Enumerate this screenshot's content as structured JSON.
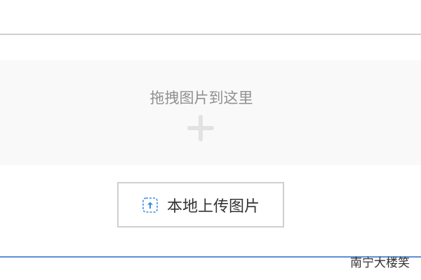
{
  "dropzone": {
    "hint": "拖拽图片到这里",
    "icon": "plus-icon"
  },
  "upload": {
    "label": "本地上传图片",
    "icon": "upload-icon",
    "accent": "#3b8be6"
  },
  "footer": {
    "partial_text": "南宁大楼笑"
  },
  "colors": {
    "dropzone_bg": "#f9f9f9",
    "bottom_line": "#5b8fd6"
  }
}
